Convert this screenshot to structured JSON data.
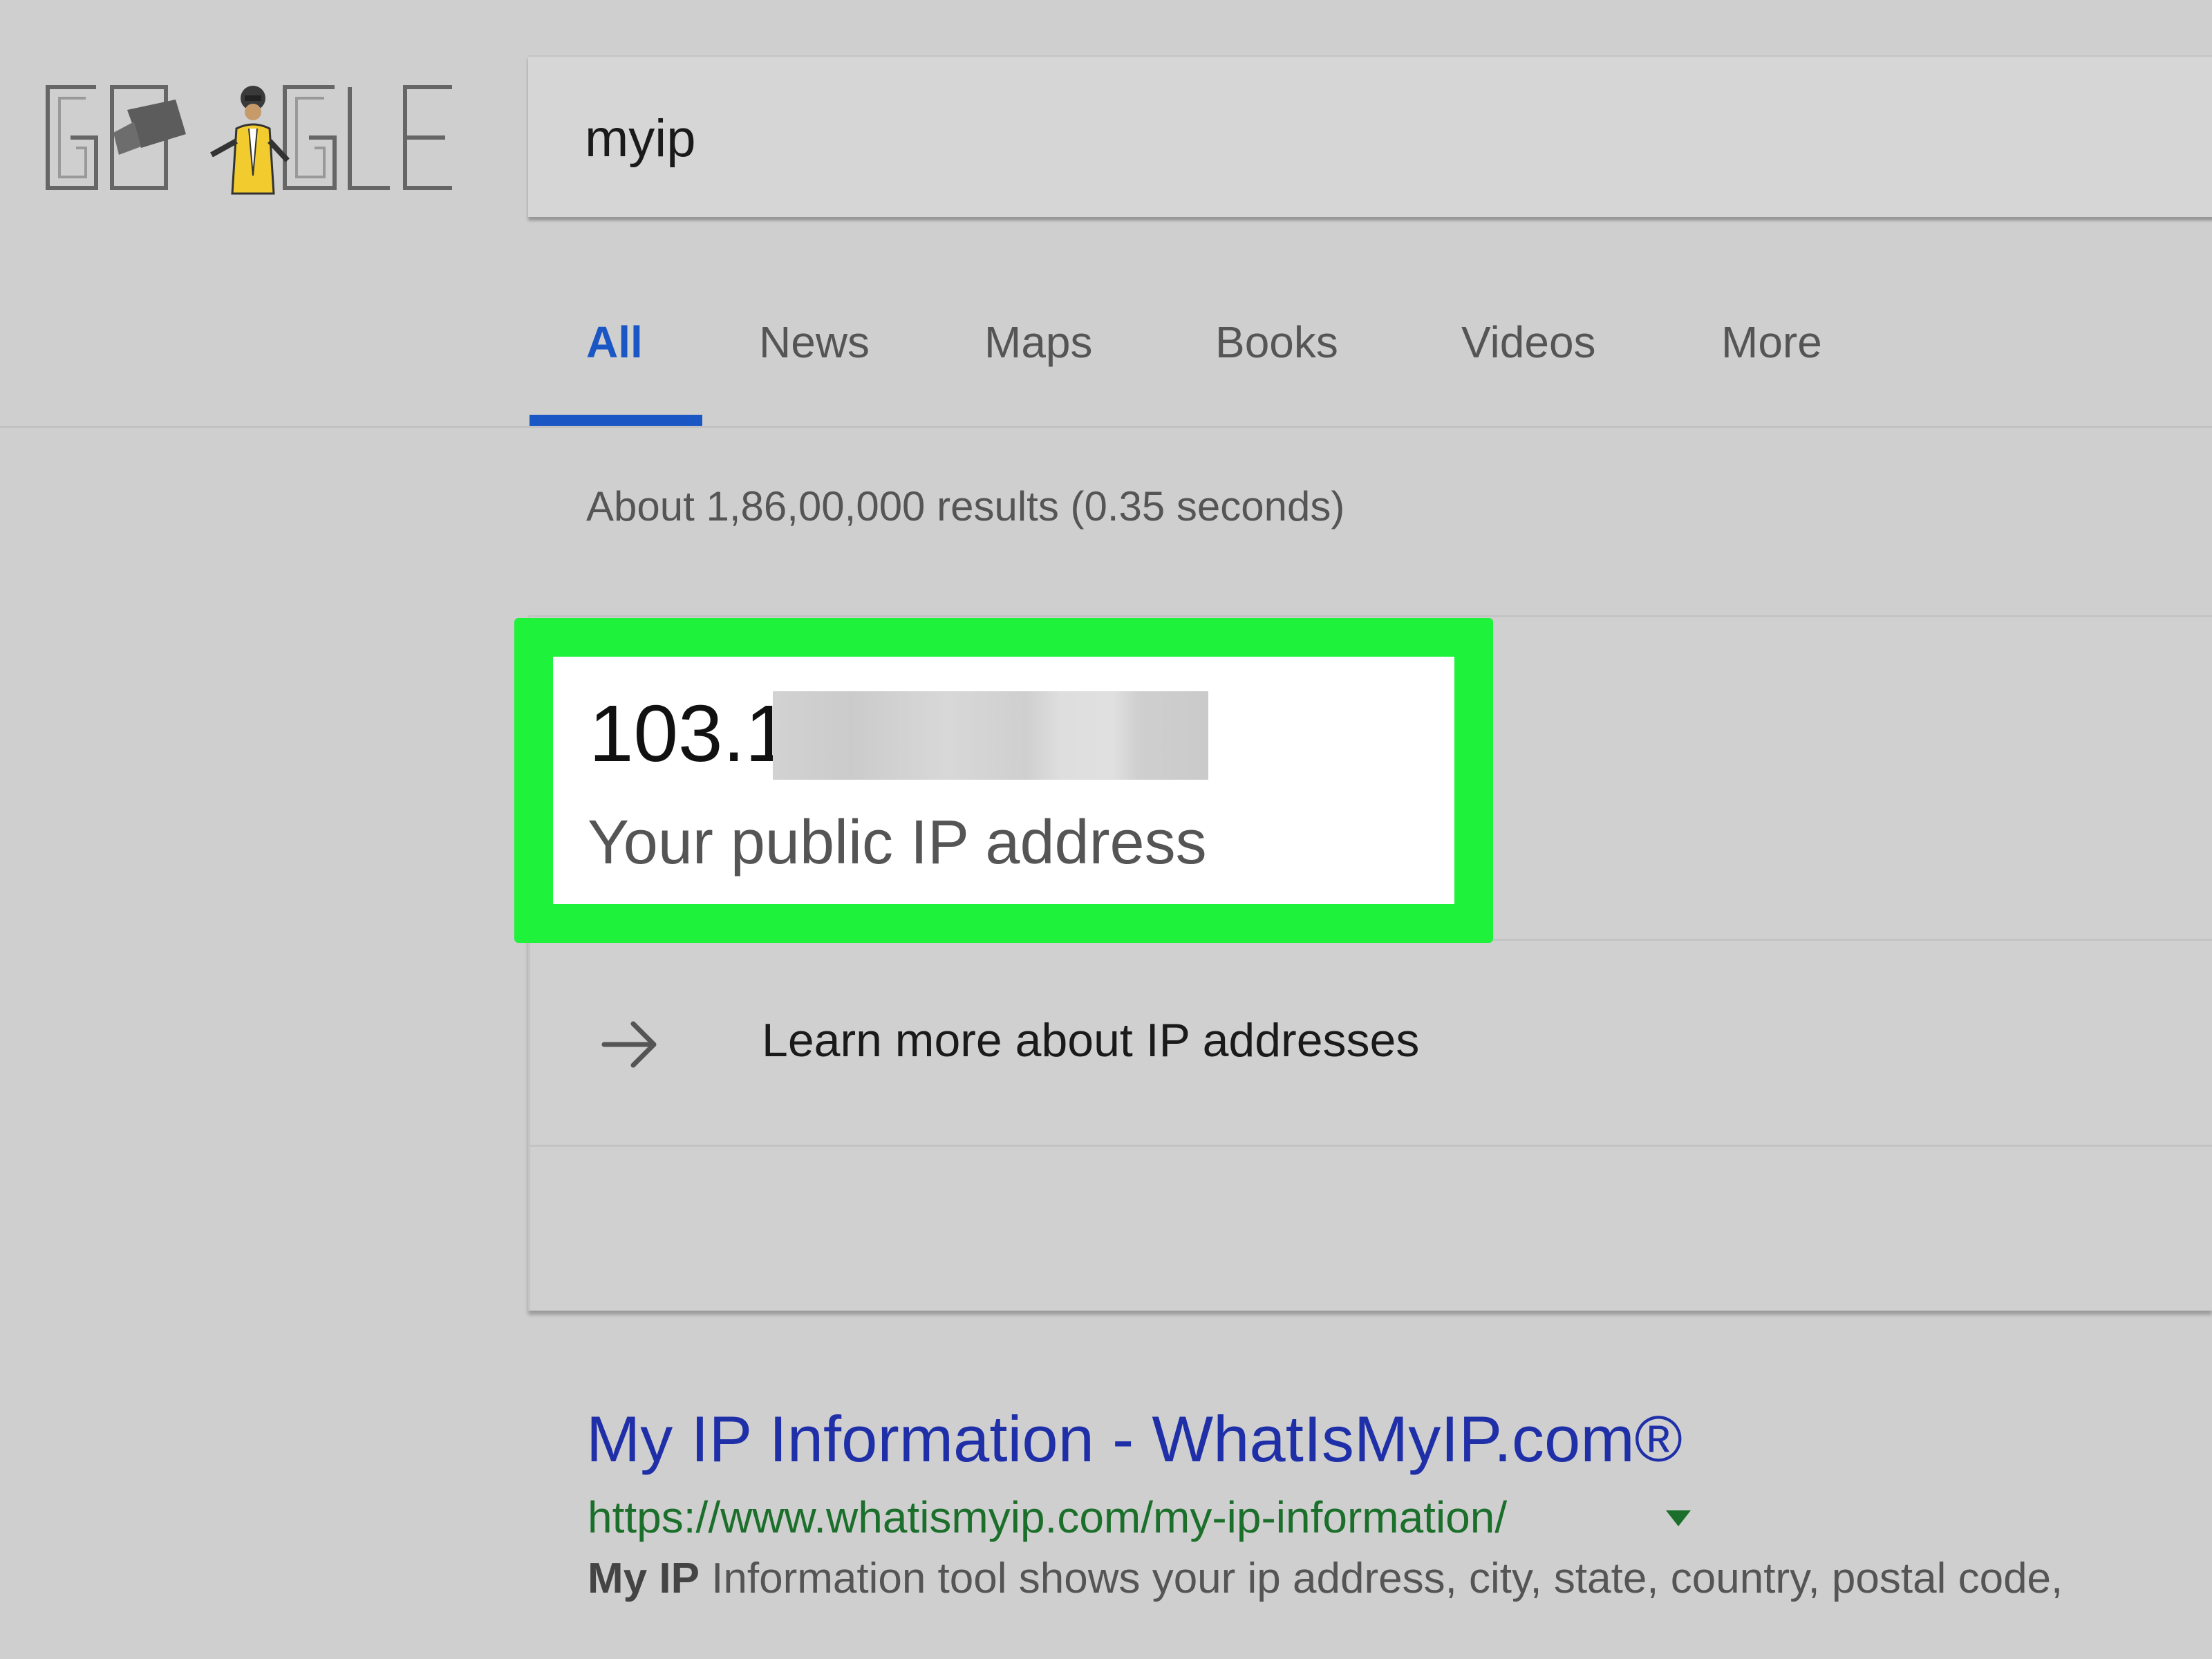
{
  "search": {
    "query": "myip"
  },
  "tabs": [
    {
      "label": "All",
      "active": true
    },
    {
      "label": "News",
      "active": false
    },
    {
      "label": "Maps",
      "active": false
    },
    {
      "label": "Books",
      "active": false
    },
    {
      "label": "Videos",
      "active": false
    },
    {
      "label": "More",
      "active": false
    }
  ],
  "result_stats": "About 1,86,00,000 results (0.35 seconds)",
  "ip_card": {
    "ip_visible_prefix": "103.1",
    "label": "Your public IP address",
    "learn_more": "Learn more about IP addresses"
  },
  "organic_result": {
    "title": "My IP Information - WhatIsMyIP.com®",
    "url": "https://www.whatismyip.com/my-ip-information/",
    "snippet_bold": "My IP",
    "snippet_rest": " Information tool shows your ip address, city, state, country, postal code,"
  },
  "colors": {
    "accent_blue": "#1a56c4",
    "highlight_green": "#1ff23a",
    "link_title": "#1f2fa8",
    "url_green": "#1b6f2b"
  },
  "icons": {
    "logo": "google-doodle-logo",
    "learn_more": "arrow-right-icon",
    "url_menu": "caret-down-icon"
  }
}
